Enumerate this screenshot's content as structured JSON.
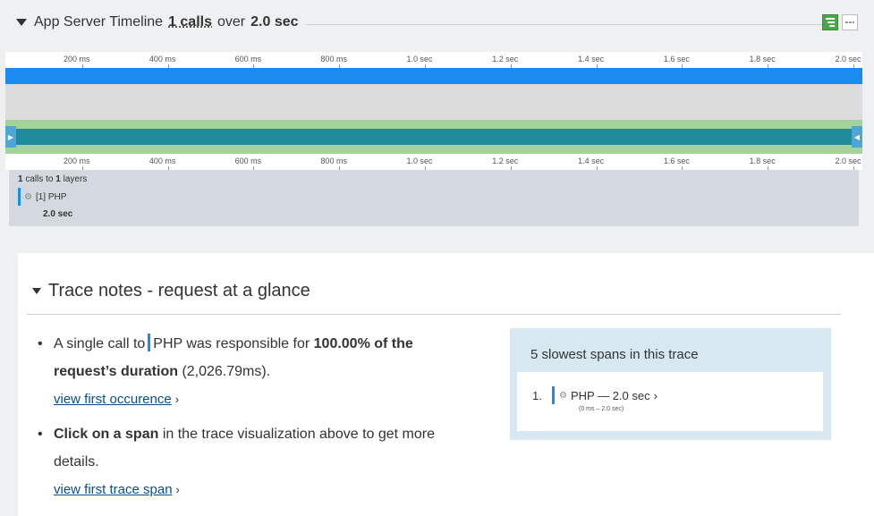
{
  "timeline": {
    "title_prefix": "App Server Timeline",
    "calls": "1 calls",
    "over": "over",
    "duration": "2.0 sec"
  },
  "ruler_ticks": [
    "200 ms",
    "400 ms",
    "600 ms",
    "800 ms",
    "1.0 sec",
    "1.2 sec",
    "1.4 sec",
    "1.6 sec",
    "1.8 sec",
    "2.0 sec"
  ],
  "layers": {
    "calls_count": "1",
    "calls_text": "calls to",
    "layers_count": "1",
    "layers_text": "layers",
    "layer_name": "[1] PHP",
    "layer_duration": "2.0 sec"
  },
  "trace_notes": {
    "title": "Trace notes - request at a glance",
    "note1_a": "A single call to",
    "note1_layer": "PHP",
    "note1_b": "was responsible for",
    "note1_percent": "100.00% of the request’s duration",
    "note1_c": "(2,026.79ms).",
    "note1_link": "view first occurence",
    "note2_bold": "Click on a span",
    "note2_text": "in the trace visualization above to get more details.",
    "note2_link": "view first trace span"
  },
  "slowest": {
    "title": "5 slowest spans in this trace",
    "items": [
      {
        "num": "1.",
        "label": "PHP — 2.0 sec",
        "range": "(0 ms – 2.0 sec)"
      }
    ]
  },
  "colors": {
    "accent_blue": "#1a8cf0",
    "teal": "#1e8a9a",
    "green": "#a4d39a",
    "link": "#0a4f8a"
  }
}
